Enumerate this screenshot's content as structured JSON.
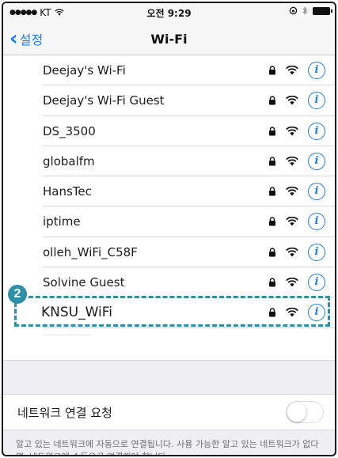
{
  "status_bar": {
    "carrier": "KT",
    "time": "오전 9:29"
  },
  "nav": {
    "back_label": "설정",
    "title": "Wi-Fi"
  },
  "networks": [
    {
      "name": "Deejay's Wi-Fi"
    },
    {
      "name": "Deejay's Wi-Fi Guest"
    },
    {
      "name": "DS_3500"
    },
    {
      "name": "globalfm"
    },
    {
      "name": "HansTec"
    },
    {
      "name": "iptime"
    },
    {
      "name": "olleh_WiFi_C58F"
    },
    {
      "name": "Solvine Guest"
    },
    {
      "name": "KNSU_WiFi"
    }
  ],
  "annotation": {
    "step_number": "2"
  },
  "ask_to_join": {
    "label": "네트워크 연결 요청",
    "enabled": false,
    "description": "알고 있는 네트워크에 자동으로 연결됩니다. 사용 가능한 알고 있는 네트워크가 없다면, 네트워크에 수동으로 연결해야 합니다."
  },
  "colors": {
    "accent": "#1a7cf6",
    "highlight": "#2e8fa8"
  }
}
